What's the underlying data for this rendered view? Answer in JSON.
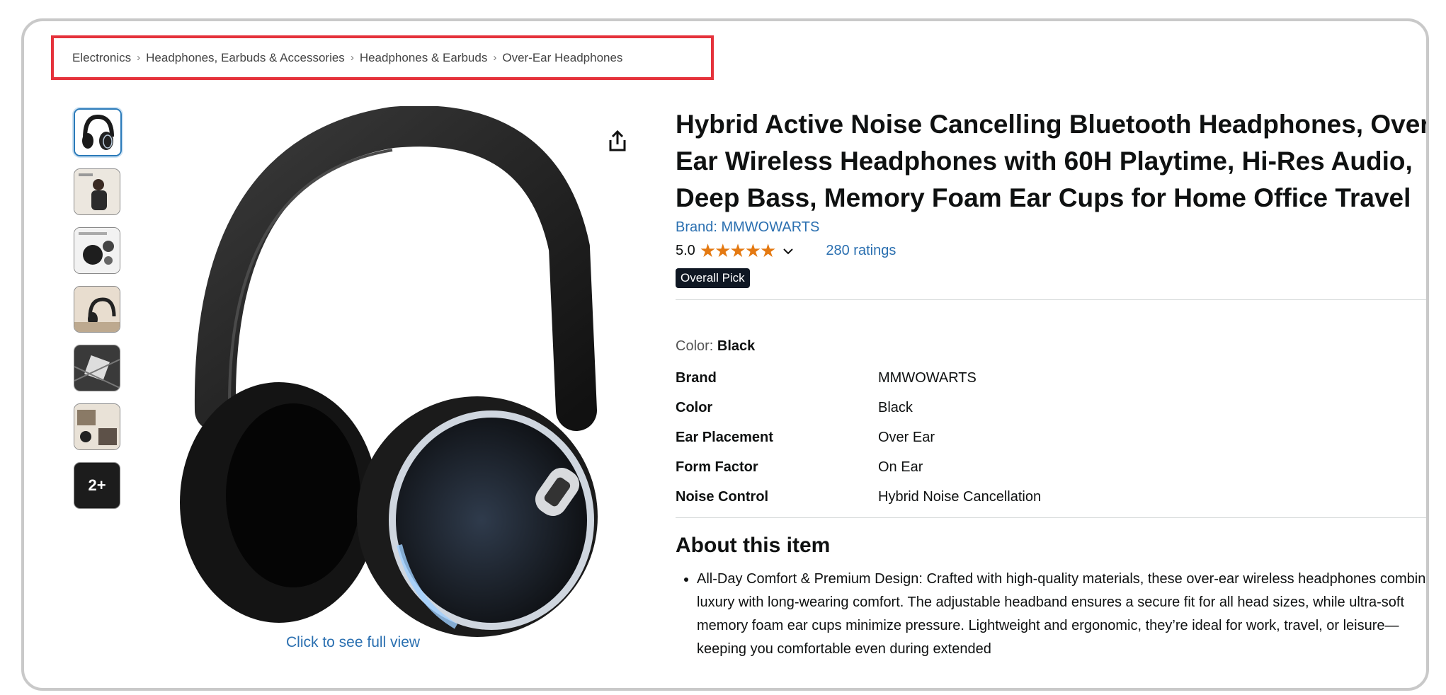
{
  "breadcrumb": {
    "items": [
      "Electronics",
      "Headphones, Earbuds & Accessories",
      "Headphones & Earbuds",
      "Over-Ear Headphones"
    ],
    "separator": "›"
  },
  "gallery": {
    "more_label": "2+",
    "full_view_label": "Click to see full view"
  },
  "product": {
    "title": "Hybrid Active Noise Cancelling Bluetooth Headphones, Over Ear Wireless Headphones with 60H Playtime, Hi-Res Audio, Deep Bass, Memory Foam Ear Cups for Home Office Travel",
    "brand_link": "Brand: MMWOWARTS",
    "rating_value": "5.0",
    "stars": "★★★★★",
    "ratings_count": "280 ratings",
    "badge": "Overall Pick",
    "color_label": "Color:",
    "color_value": "Black"
  },
  "specs": [
    {
      "key": "Brand",
      "value": "MMWOWARTS"
    },
    {
      "key": "Color",
      "value": "Black"
    },
    {
      "key": "Ear Placement",
      "value": "Over Ear"
    },
    {
      "key": "Form Factor",
      "value": "On Ear"
    },
    {
      "key": "Noise Control",
      "value": "Hybrid Noise Cancellation"
    }
  ],
  "about": {
    "heading": "About this item",
    "bullets": [
      "All-Day Comfort & Premium Design: Crafted with high-quality materials, these over-ear wireless headphones combine luxury with long-wearing comfort. The adjustable headband ensures a secure fit for all head sizes, while ultra-soft memory foam ear cups minimize pressure. Lightweight and ergonomic, they’re ideal for work, travel, or leisure—keeping you comfortable even during extended"
    ]
  },
  "colors": {
    "link": "#2a6fb0",
    "star": "#e47911",
    "badge_bg": "#0f1723",
    "highlight_border": "#e5323b"
  },
  "icons": [
    "share-icon",
    "chevron-down-icon"
  ]
}
